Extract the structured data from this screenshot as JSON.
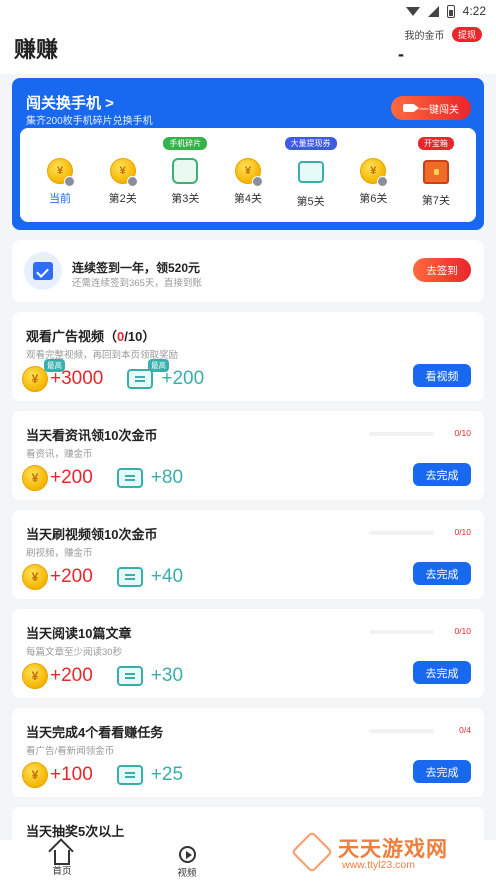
{
  "status_bar": {
    "time": "4:22"
  },
  "header": {
    "title": "赚赚",
    "coins_label": "我的金币",
    "withdraw_label": "提现",
    "coin_value": "-"
  },
  "challenge": {
    "title": "闯关换手机 >",
    "subtitle": "集齐200枚手机碎片兑换手机",
    "button_label": "一键闯关",
    "stages": [
      {
        "label": "当前",
        "badge": "",
        "icon": "coin-icon"
      },
      {
        "label": "第2关",
        "badge": "",
        "icon": "coin-icon"
      },
      {
        "label": "第3关",
        "badge": "手机碎片",
        "icon": "puzzle-icon"
      },
      {
        "label": "第4关",
        "badge": "",
        "icon": "coin-icon"
      },
      {
        "label": "第5关",
        "badge": "大量提现券",
        "icon": "ticket-icon"
      },
      {
        "label": "第6关",
        "badge": "",
        "icon": "coin-icon"
      },
      {
        "label": "第7关",
        "badge": "开宝箱",
        "icon": "treasure-chest-icon"
      }
    ]
  },
  "checkin": {
    "title": "连续签到一年，领520元",
    "subtitle": "还需连续签到365天，直接到账",
    "button_label": "去签到"
  },
  "tasks": [
    {
      "title_prefix": "观看广告视频（",
      "count": "0",
      "title_suffix": "/10）",
      "subtitle": "观看完整视频，再回到本页领取奖励",
      "coins": "+3000",
      "tickets": "+200",
      "tag": "最高",
      "button_label": "看视频",
      "progress_text": ""
    },
    {
      "title": "当天看资讯领10次金币",
      "subtitle": "看资讯，赚金币",
      "coins": "+200",
      "tickets": "+80",
      "button_label": "去完成",
      "progress_text": "0/10",
      "progress": 0
    },
    {
      "title": "当天刷视频领10次金币",
      "subtitle": "刷视频，赚金币",
      "coins": "+200",
      "tickets": "+40",
      "button_label": "去完成",
      "progress_text": "0/10",
      "progress": 0
    },
    {
      "title": "当天阅读10篇文章",
      "subtitle": "每篇文章至少阅读30秒",
      "coins": "+200",
      "tickets": "+30",
      "button_label": "去完成",
      "progress_text": "0/10",
      "progress": 0
    },
    {
      "title": "当天完成4个看看赚任务",
      "subtitle": "看广告/看新闻领金币",
      "coins": "+100",
      "tickets": "+25",
      "button_label": "去完成",
      "progress_text": "0/4",
      "progress": 0
    },
    {
      "title": "当天抽奖5次以上"
    }
  ],
  "coin_symbol": "¥",
  "nav": [
    {
      "label": "首页",
      "icon": "home-icon"
    },
    {
      "label": "视频",
      "icon": "video-icon"
    }
  ],
  "watermark": {
    "title": "天天游戏网",
    "url": "www.ttyl23.com"
  },
  "colors": {
    "primary": "#1869f0",
    "accent_red": "#e8262b",
    "ticket_teal": "#3aaeaa",
    "coin_gold": "#f5b500"
  }
}
